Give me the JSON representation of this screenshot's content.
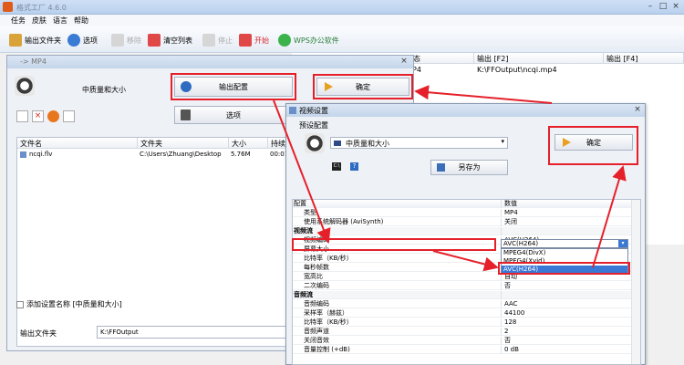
{
  "app": {
    "title": "格式工厂 4.6.0",
    "menu": [
      "任务",
      "皮肤",
      "语言",
      "帮助"
    ]
  },
  "toolbar": {
    "items": [
      {
        "label": "输出文件夹",
        "icon": "folder-icon",
        "color": "#d9a33a"
      },
      {
        "label": "选项",
        "icon": "options-icon",
        "color": "#3a7bd5"
      },
      {
        "label": "移除",
        "icon": "remove-icon",
        "color": "#d6d6d6"
      },
      {
        "label": "清空列表",
        "icon": "clear-list-icon",
        "color": "#e04848"
      },
      {
        "label": "停止",
        "icon": "stop-icon",
        "color": "#d6d6d6"
      },
      {
        "label": "开始",
        "icon": "start-icon",
        "color": "#e04848"
      },
      {
        "label": "WPS办公软件",
        "icon": "wps-icon",
        "color": "#3bb34a"
      }
    ]
  },
  "bg_table": {
    "headers": [
      "态",
      "输出 [F2]",
      "输出 [F4]"
    ],
    "row": [
      "P4",
      "K:\\FFOutput\\ncqi.mp4",
      ""
    ]
  },
  "left_dialog": {
    "title": "-> MP4",
    "preset_label": "中质量和大小",
    "output_config_button": "输出配置",
    "ok_button": "确定",
    "options_button": "选项",
    "file_table": {
      "headers": [
        "文件名",
        "文件夹",
        "大小",
        "持续"
      ],
      "rows": [
        [
          "ncqi.flv",
          "C:\\Users\\Zhuang\\Desktop",
          "5.76M",
          "00:01"
        ]
      ]
    },
    "add_setting_checkbox": "添加设置名称 [中质量和大小]",
    "output_folder_label": "输出文件夹",
    "output_folder_value": "K:\\FFOutput"
  },
  "right_dialog": {
    "title": "视频设置",
    "preset_section": "预设配置",
    "preset_value": "中质量和大小",
    "ok_button": "确定",
    "save_as_button": "另存为",
    "table_headers": [
      "配置",
      "数值"
    ],
    "rows": [
      {
        "k": "类型",
        "v": "MP4",
        "cat": false
      },
      {
        "k": "使用系统解码器 (AviSynth)",
        "v": "关闭",
        "cat": false
      },
      {
        "k": "视频流",
        "v": "",
        "cat": true
      },
      {
        "k": "视频编码",
        "v": "AVC(H264)",
        "cat": false
      },
      {
        "k": "屏幕大小",
        "v": "MPEG4(DivX)",
        "cat": false
      },
      {
        "k": "比特率（KB/秒）",
        "v": "MPEG4(Xvid)",
        "cat": false
      },
      {
        "k": "每秒帧数",
        "v": "AVC(H264)",
        "cat": false
      },
      {
        "k": "宽高比",
        "v": "自动",
        "cat": false
      },
      {
        "k": "二次编码",
        "v": "否",
        "cat": false
      },
      {
        "k": "音频流",
        "v": "",
        "cat": true
      },
      {
        "k": "音频编码",
        "v": "AAC",
        "cat": false
      },
      {
        "k": "采样率（赫兹）",
        "v": "44100",
        "cat": false
      },
      {
        "k": "比特率（KB/秒）",
        "v": "128",
        "cat": false
      },
      {
        "k": "音频声道",
        "v": "2",
        "cat": false
      },
      {
        "k": "关闭音效",
        "v": "否",
        "cat": false
      },
      {
        "k": "音量控制 (+dB)",
        "v": "0 dB",
        "cat": false
      }
    ],
    "dropdown_options": [
      "MPEG4(DivX)",
      "MPEG4(Xvid)",
      "AVC(H264)"
    ],
    "selected_codec": "AVC(H264)"
  },
  "colors": {
    "highlight": "#e5202a",
    "selection": "#3a78d6"
  }
}
